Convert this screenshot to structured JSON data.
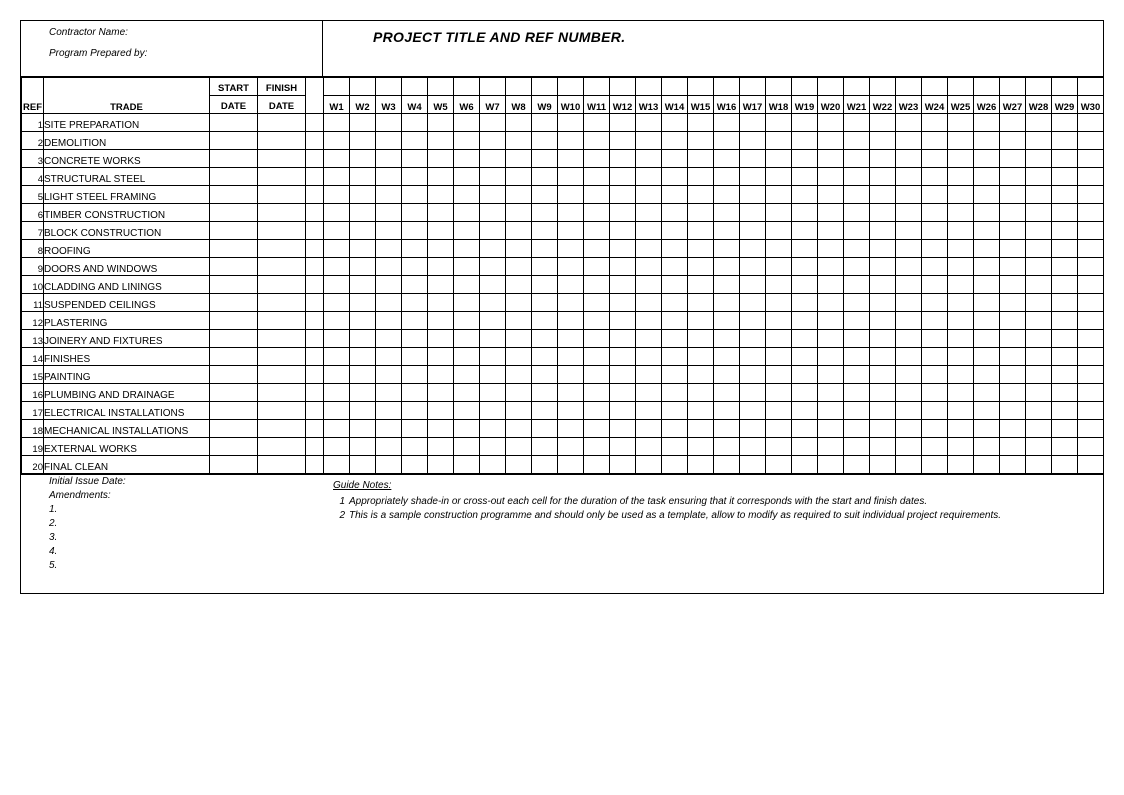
{
  "header": {
    "contractor_label": "Contractor Name:",
    "prepared_label": "Program Prepared by:",
    "project_title": "PROJECT TITLE AND REF NUMBER."
  },
  "columns": {
    "ref": "REF",
    "trade": "TRADE",
    "start_line1": "START",
    "start_line2": "DATE",
    "finish_line1": "FINISH",
    "finish_line2": "DATE"
  },
  "weeks": [
    "W1",
    "W2",
    "W3",
    "W4",
    "W5",
    "W6",
    "W7",
    "W8",
    "W9",
    "W10",
    "W11",
    "W12",
    "W13",
    "W14",
    "W15",
    "W16",
    "W17",
    "W18",
    "W19",
    "W20",
    "W21",
    "W22",
    "W23",
    "W24",
    "W25",
    "W26",
    "W27",
    "W28",
    "W29",
    "W30"
  ],
  "rows": [
    {
      "ref": "1",
      "trade": "SITE PREPARATION"
    },
    {
      "ref": "2",
      "trade": "DEMOLITION"
    },
    {
      "ref": "3",
      "trade": "CONCRETE WORKS"
    },
    {
      "ref": "4",
      "trade": "STRUCTURAL STEEL"
    },
    {
      "ref": "5",
      "trade": "LIGHT STEEL FRAMING"
    },
    {
      "ref": "6",
      "trade": "TIMBER CONSTRUCTION"
    },
    {
      "ref": "7",
      "trade": "BLOCK CONSTRUCTION"
    },
    {
      "ref": "8",
      "trade": "ROOFING"
    },
    {
      "ref": "9",
      "trade": "DOORS AND WINDOWS"
    },
    {
      "ref": "10",
      "trade": "CLADDING AND LININGS"
    },
    {
      "ref": "11",
      "trade": "SUSPENDED CEILINGS"
    },
    {
      "ref": "12",
      "trade": "PLASTERING"
    },
    {
      "ref": "13",
      "trade": "JOINERY AND FIXTURES"
    },
    {
      "ref": "14",
      "trade": "FINISHES"
    },
    {
      "ref": "15",
      "trade": "PAINTING"
    },
    {
      "ref": "16",
      "trade": "PLUMBING AND DRAINAGE"
    },
    {
      "ref": "17",
      "trade": "ELECTRICAL INSTALLATIONS"
    },
    {
      "ref": "18",
      "trade": "MECHANICAL INSTALLATIONS"
    },
    {
      "ref": "19",
      "trade": "EXTERNAL WORKS"
    },
    {
      "ref": "20",
      "trade": "FINAL CLEAN"
    }
  ],
  "footer": {
    "issue_label": "Initial Issue Date:",
    "amend_label": "Amendments:",
    "amend_nums": [
      "1.",
      "2.",
      "3.",
      "4.",
      "5."
    ],
    "guide_title": "Guide Notes:",
    "notes": [
      {
        "num": "1",
        "text": "Appropriately shade-in or cross-out each cell for the duration of the task ensuring that it corresponds with the start and finish dates."
      },
      {
        "num": "2",
        "text": "This is a sample construction programme and should only be used as a template, allow to modify as required to suit individual project requirements."
      }
    ]
  }
}
